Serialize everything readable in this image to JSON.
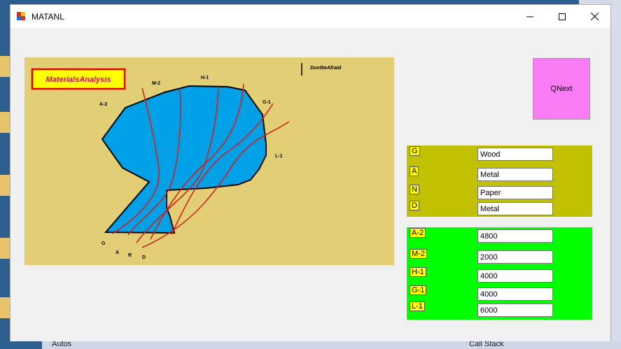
{
  "window": {
    "title": "MATANL"
  },
  "map": {
    "badge": "MaterialsAnalysis",
    "signature": "DontbeAfraid",
    "labels": [
      "M-2",
      "H-1",
      "A-2",
      "G-1",
      "L-1",
      "G",
      "A",
      "R",
      "D"
    ]
  },
  "qnext": {
    "label": "QNext"
  },
  "materials": [
    {
      "tag": "G",
      "value": "Wood"
    },
    {
      "tag": "A",
      "value": "Metal"
    },
    {
      "tag": "N",
      "value": "Paper"
    },
    {
      "tag": "D",
      "value": "Metal"
    }
  ],
  "quantities": [
    {
      "tag": "A-2",
      "value": "4800"
    },
    {
      "tag": "M-2",
      "value": "2000"
    },
    {
      "tag": "H-1",
      "value": "4000"
    },
    {
      "tag": "G-1",
      "value": "4000"
    },
    {
      "tag": "L-1",
      "value": "6000"
    }
  ],
  "background": {
    "bottom_left": "Autos",
    "bottom_right": "Call Stack"
  },
  "colors": {
    "map_bg": "#e2cf75",
    "blob": "#00a0e6",
    "olive": "#c0c000",
    "green": "#00ff00",
    "qnext": "#f97cf5",
    "tag": "#ffff00"
  }
}
